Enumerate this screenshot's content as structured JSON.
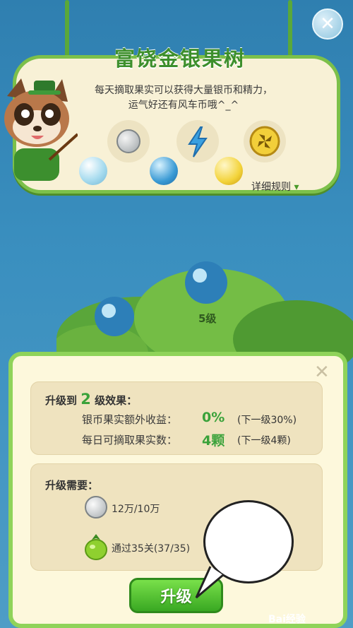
{
  "header": {
    "close_symbol": "✕"
  },
  "banner": {
    "title": "富饶金银果树",
    "desc_line1": "每天摘取果实可以获得大量银币和精力，",
    "desc_line2": "运气好还有风车币哦^_^",
    "rewards": [
      {
        "icon": "silver-coin-icon"
      },
      {
        "icon": "energy-bolt-icon"
      },
      {
        "icon": "windmill-coin-icon"
      }
    ],
    "rules_link": "详细规则",
    "rules_arrow": "▾"
  },
  "tree": {
    "level_label": "5级"
  },
  "panel": {
    "close_symbol": "✕",
    "effect": {
      "heading_prefix": "升级到",
      "heading_level": "2",
      "heading_suffix": "级效果：",
      "rows": [
        {
          "label": "银币果实额外收益：",
          "value": "0%",
          "next": "(下一级30%)"
        },
        {
          "label": "每日可摘取果实数：",
          "value": "4颗",
          "next": "(下一级4颗)"
        }
      ]
    },
    "requirements": {
      "heading": "升级需要：",
      "items": [
        {
          "icon": "silver-coin-icon",
          "text": "12万/10万"
        },
        {
          "icon": "green-fruit-icon",
          "text": "通过35关(37/35)"
        }
      ]
    },
    "upgrade_button": "升级"
  },
  "watermark": "Bai经验",
  "colors": {
    "accent_green": "#3aa23a",
    "frame_green": "#8fd35a",
    "panel_bg": "#fdf8dc"
  }
}
